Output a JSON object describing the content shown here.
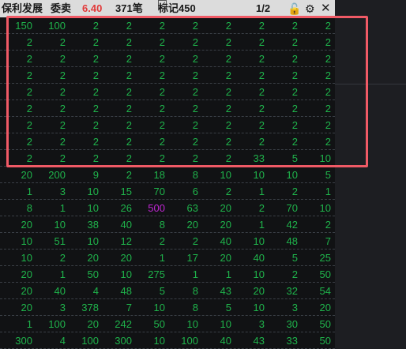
{
  "header": {
    "stock_name": "保利发展",
    "order_type": "委卖",
    "price": "6.40",
    "order_count": "371笔",
    "mark_label": "标记450",
    "page": "1/2",
    "lock_glyph": "🔓",
    "settings_glyph": "⚙",
    "close_glyph": "✕"
  },
  "colors": {
    "value": "#1fb34b",
    "highlight": "#c026d3",
    "price": "#e23a3a",
    "selection_border": "#f05a66"
  },
  "highlighted_cell": {
    "row": 11,
    "col": 4
  },
  "rows": [
    [
      "150",
      "100",
      "2",
      "2",
      "2",
      "2",
      "2",
      "2",
      "2",
      "2"
    ],
    [
      "2",
      "2",
      "2",
      "2",
      "2",
      "2",
      "2",
      "2",
      "2",
      "2"
    ],
    [
      "2",
      "2",
      "2",
      "2",
      "2",
      "2",
      "2",
      "2",
      "2",
      "2"
    ],
    [
      "2",
      "2",
      "2",
      "2",
      "2",
      "2",
      "2",
      "2",
      "2",
      "2"
    ],
    [
      "2",
      "2",
      "2",
      "2",
      "2",
      "2",
      "2",
      "2",
      "2",
      "2"
    ],
    [
      "2",
      "2",
      "2",
      "2",
      "2",
      "2",
      "2",
      "2",
      "2",
      "2"
    ],
    [
      "2",
      "2",
      "2",
      "2",
      "2",
      "2",
      "2",
      "2",
      "2",
      "2"
    ],
    [
      "2",
      "2",
      "2",
      "2",
      "2",
      "2",
      "2",
      "2",
      "2",
      "2"
    ],
    [
      "2",
      "2",
      "2",
      "2",
      "2",
      "2",
      "2",
      "33",
      "5",
      "10"
    ],
    [
      "20",
      "200",
      "9",
      "2",
      "18",
      "8",
      "10",
      "10",
      "10",
      "5"
    ],
    [
      "1",
      "3",
      "10",
      "15",
      "70",
      "6",
      "2",
      "1",
      "2",
      "1"
    ],
    [
      "8",
      "1",
      "10",
      "26",
      "500",
      "63",
      "20",
      "2",
      "70",
      "10"
    ],
    [
      "20",
      "10",
      "38",
      "40",
      "8",
      "20",
      "20",
      "1",
      "42",
      "2"
    ],
    [
      "10",
      "51",
      "10",
      "12",
      "2",
      "2",
      "40",
      "10",
      "48",
      "7"
    ],
    [
      "10",
      "2",
      "20",
      "20",
      "1",
      "17",
      "20",
      "40",
      "5",
      "25"
    ],
    [
      "20",
      "1",
      "50",
      "10",
      "275",
      "1",
      "1",
      "10",
      "2",
      "50"
    ],
    [
      "20",
      "40",
      "4",
      "48",
      "5",
      "8",
      "43",
      "20",
      "32",
      "54"
    ],
    [
      "20",
      "3",
      "378",
      "7",
      "10",
      "8",
      "5",
      "10",
      "3",
      "20"
    ],
    [
      "1",
      "100",
      "20",
      "242",
      "50",
      "10",
      "10",
      "3",
      "30",
      "50"
    ],
    [
      "300",
      "4",
      "100",
      "300",
      "10",
      "100",
      "40",
      "43",
      "33",
      "50"
    ]
  ]
}
